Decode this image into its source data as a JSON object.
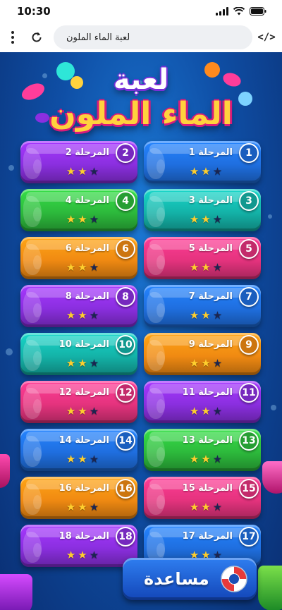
{
  "status": {
    "time": "10:30"
  },
  "browser": {
    "url": "لعبة الماء الملون"
  },
  "game": {
    "title_line1": "لعبة",
    "title_line2": "الماء الملون",
    "levels": [
      {
        "number": "1",
        "label": "المرحلة 1",
        "stars": 2,
        "color": "#1f6fe0"
      },
      {
        "number": "2",
        "label": "المرحلة 2",
        "stars": 2,
        "color": "#8b2fe0"
      },
      {
        "number": "3",
        "label": "المرحلة 3",
        "stars": 2,
        "color": "#14b3a8"
      },
      {
        "number": "4",
        "label": "المرحلة 4",
        "stars": 2,
        "color": "#2dba3c"
      },
      {
        "number": "5",
        "label": "المرحلة 5",
        "stars": 2,
        "color": "#e5337e"
      },
      {
        "number": "6",
        "label": "المرحلة 6",
        "stars": 2,
        "color": "#f08a12"
      },
      {
        "number": "7",
        "label": "المرحلة 7",
        "stars": 2,
        "color": "#1f6fe0"
      },
      {
        "number": "8",
        "label": "المرحلة 8",
        "stars": 2,
        "color": "#8b2fe0"
      },
      {
        "number": "9",
        "label": "المرحلة 9",
        "stars": 2,
        "color": "#f08a12"
      },
      {
        "number": "10",
        "label": "المرحلة 10",
        "stars": 2,
        "color": "#14b3a8"
      },
      {
        "number": "11",
        "label": "المرحلة 11",
        "stars": 2,
        "color": "#8b2fe0"
      },
      {
        "number": "12",
        "label": "المرحلة 12",
        "stars": 2,
        "color": "#e5337e"
      },
      {
        "number": "13",
        "label": "المرحلة 13",
        "stars": 2,
        "color": "#2dba3c"
      },
      {
        "number": "14",
        "label": "المرحلة 14",
        "stars": 2,
        "color": "#1f6fe0"
      },
      {
        "number": "15",
        "label": "المرحلة 15",
        "stars": 2,
        "color": "#e5337e"
      },
      {
        "number": "16",
        "label": "المرحلة 16",
        "stars": 2,
        "color": "#f08a12"
      },
      {
        "number": "17",
        "label": "المرحلة 17",
        "stars": 2,
        "color": "#1f6fe0"
      },
      {
        "number": "18",
        "label": "المرحلة 18",
        "stars": 2,
        "color": "#8b2fe0"
      }
    ],
    "max_stars": 3,
    "help_label": "مساعدة"
  },
  "icons": {
    "reload": "reload-icon",
    "menu": "more-vert-icon",
    "code": "code-icon",
    "help": "lifebuoy-icon",
    "star": "star-icon"
  }
}
